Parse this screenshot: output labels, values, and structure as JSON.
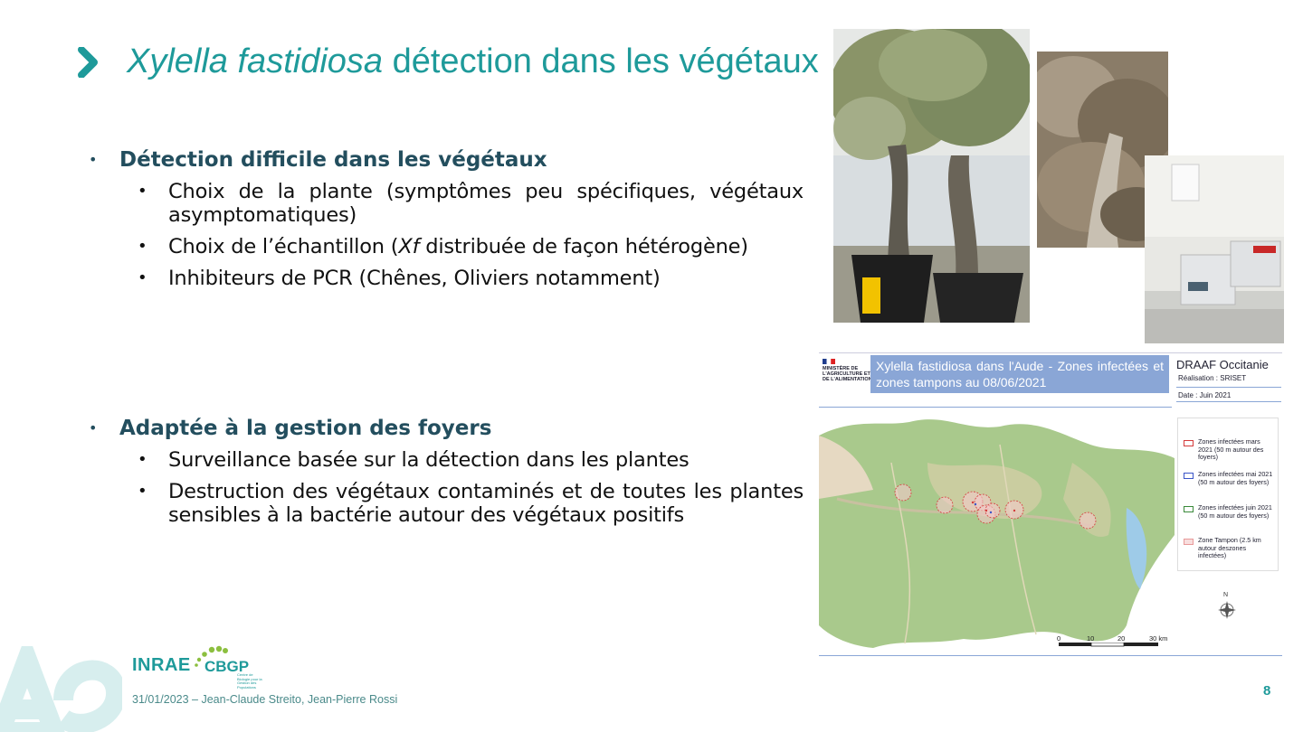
{
  "title": {
    "italic": "Xylella fastidiosa",
    "rest": " détection dans les végétaux"
  },
  "section1": {
    "heading": "Détection difficile dans les végétaux",
    "bullets": [
      {
        "text": "Choix de la plante (symptômes peu spécifiques, végétaux asymptomatiques)"
      },
      {
        "before": "Choix de l’échantillon (",
        "italic": "Xf",
        "after": " distribuée de façon hétérogène)"
      },
      {
        "text": "Inhibiteurs de PCR (Chênes, Oliviers notamment)"
      }
    ]
  },
  "section2": {
    "heading": "Adaptée à la gestion des foyers",
    "bullets": [
      {
        "text": "Surveillance basée sur la détection dans les plantes"
      },
      {
        "text": "Destruction des végétaux contaminés et de toutes les plantes sensibles à la bactérie autour des végétaux positifs"
      }
    ]
  },
  "map": {
    "ministere": "MINISTÈRE DE L'AGRICULTURE ET DE L'ALIMENTATION",
    "title": "Xylella fastidiosa dans l'Aude - Zones infectées et zones tampons au 08/06/2021",
    "org": "DRAAF Occitanie",
    "realisation": "Réalisation : SRISET",
    "date": "Date : Juin 2021",
    "legend": [
      {
        "label": "Zones infectées mars 2021 (50 m autour des foyers)",
        "color": "#d43b3b"
      },
      {
        "label": "Zones infectées mai 2021 (50 m autour des foyers)",
        "color": "#3a55c8"
      },
      {
        "label": "Zones infectées juin 2021 (50 m autour des foyers)",
        "color": "#3a8a3a"
      },
      {
        "label": "Zone Tampon (2.5 km autour deszones infectées)",
        "color": "#e89a9a"
      }
    ],
    "north": "N",
    "scale": [
      "0",
      "10",
      "20",
      "30 km"
    ]
  },
  "footer": {
    "logo_inrae": "INRAE",
    "logo_cbgp": "CBGP",
    "logo_cbgp_sub": "Centre de Biologie pour la Gestion des Populations",
    "credit": "31/01/2023 – Jean-Claude Streito, Jean-Pierre Rossi",
    "page_number": "8"
  },
  "colors": {
    "accent": "#1e9a9a",
    "heading": "#234e5e",
    "map_title_bg": "#8aa6d6"
  }
}
